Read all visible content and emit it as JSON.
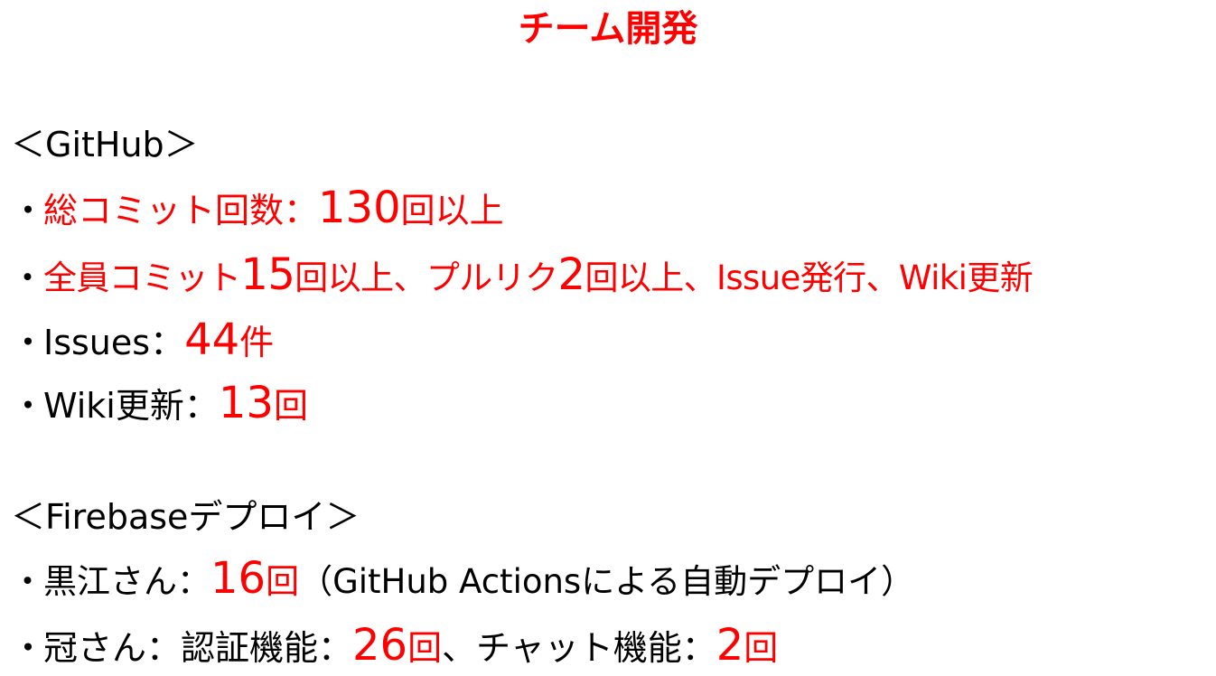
{
  "title": "チーム開発",
  "colors": {
    "accent": "#ff0000",
    "text": "#000000",
    "background": "#ffffff"
  },
  "bullet": "・",
  "github": {
    "heading": "＜GitHub＞",
    "total_commits": {
      "label": "総コミット回数：",
      "value": "130",
      "unit": "回以上"
    },
    "everyone": {
      "text_a": "全員コミット",
      "value_a": "15",
      "text_b": "回以上、プルリク",
      "value_b": "2",
      "text_c": "回以上、Issue発行、Wiki更新"
    },
    "issues": {
      "label": "Issues：",
      "value": "44",
      "unit": "件"
    },
    "wiki": {
      "label": "Wiki更新：",
      "value": "13",
      "unit": "回"
    }
  },
  "firebase": {
    "heading": "＜Firebaseデプロイ＞",
    "kuroe": {
      "label": "黒江さん：",
      "value": "16",
      "unit": "回",
      "note": "（GitHub Actionsによる自動デプロイ）"
    },
    "kanmuri": {
      "label": "冠さん：認証機能：",
      "value_a": "26",
      "unit_a": "回",
      "mid": "、チャット機能：",
      "value_b": "2",
      "unit_b": "回"
    }
  }
}
